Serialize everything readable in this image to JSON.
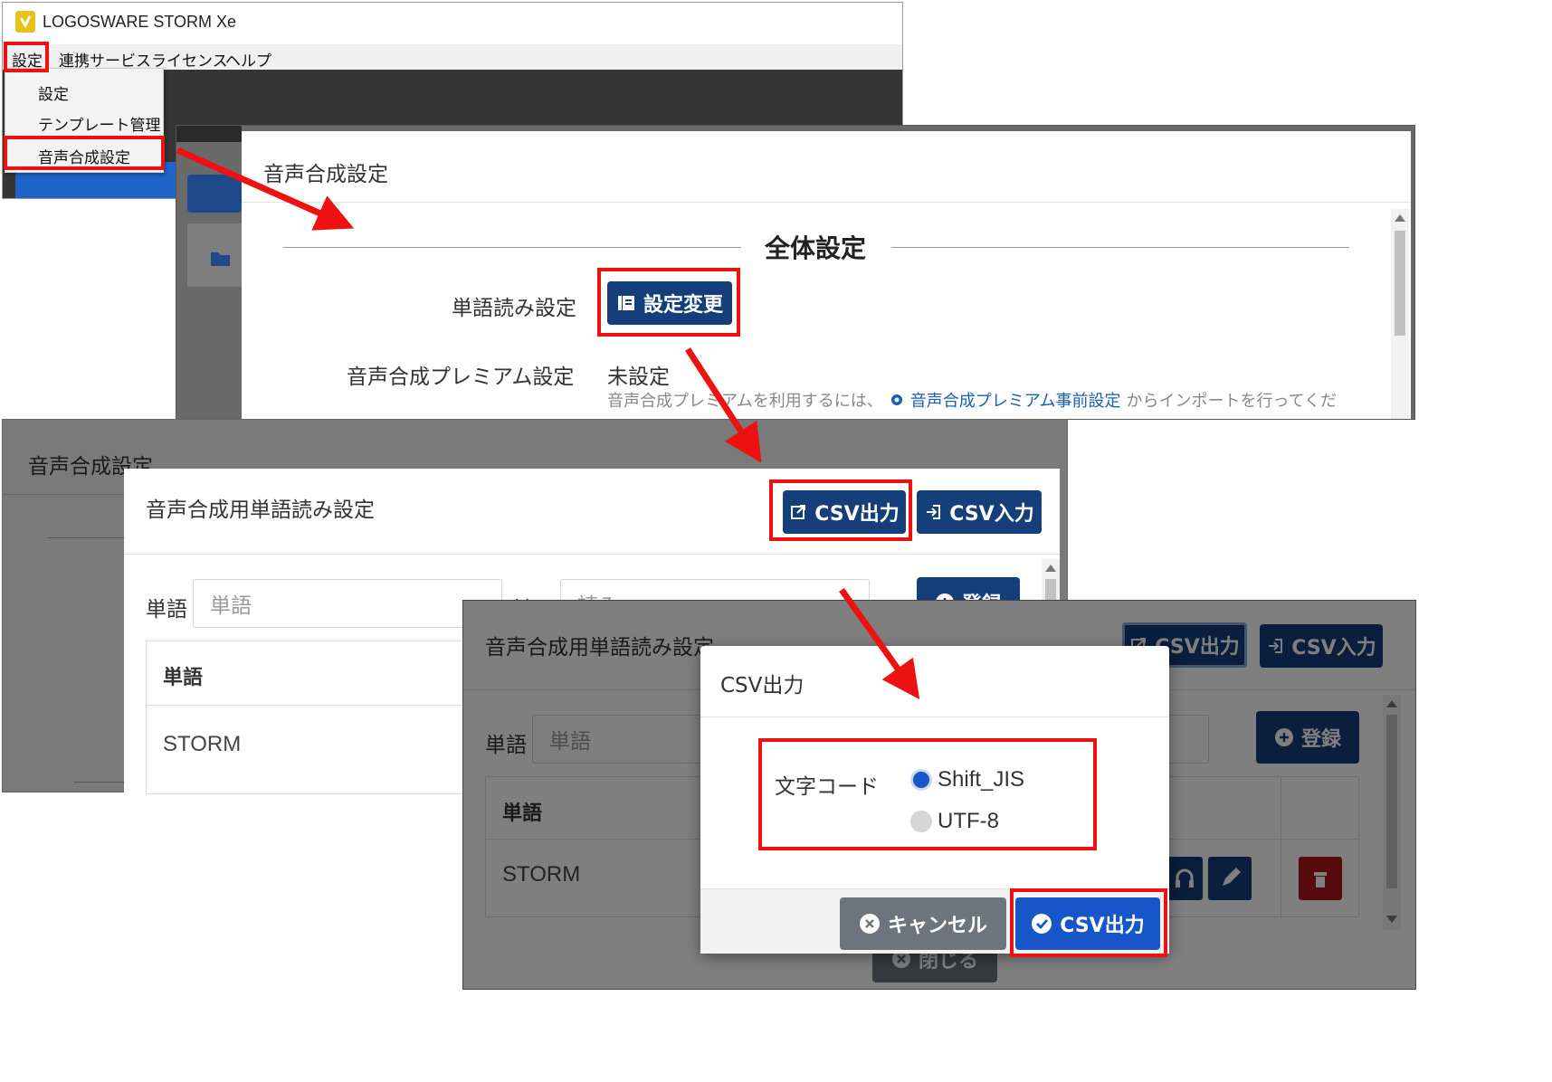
{
  "app": {
    "title": "LOGOSWARE STORM Xe",
    "menubar": [
      "設定",
      "連携サービス",
      "ライセンス",
      "ヘルプ"
    ],
    "dropdown": [
      "設定",
      "テンプレート管理",
      "音声合成設定"
    ]
  },
  "voice_settings": {
    "title": "音声合成設定",
    "section_heading": "全体設定",
    "word_reading_label": "単語読み設定",
    "change_button": "設定変更",
    "premium_label": "音声合成プレミアム設定",
    "premium_value": "未設定",
    "premium_note_before": "音声合成プレミアムを利用するには、",
    "premium_link": "音声合成プレミアム事前設定",
    "premium_note_after": "からインポートを行ってくだ"
  },
  "word_dialog": {
    "bg_title": "音声合成設定",
    "title": "音声合成用単語読み設定",
    "csv_export": "CSV出力",
    "csv_import": "CSV入力",
    "word_label": "単語",
    "word_placeholder": "単語",
    "reading_label": "読み",
    "reading_placeholder": "読み",
    "register": "登録",
    "col_word": "単語",
    "row_word": "STORM",
    "close": "閉じる"
  },
  "csv_dialog": {
    "title": "CSV出力",
    "encoding_label": "文字コード",
    "options": [
      {
        "label": "Shift_JIS",
        "selected": true
      },
      {
        "label": "UTF-8",
        "selected": false
      }
    ],
    "cancel": "キャンセル",
    "ok": "CSV出力"
  },
  "colors": {
    "highlight": "#ee1111",
    "primary": "#143f7a",
    "danger": "#b0171b",
    "link": "#1a5fb4"
  }
}
